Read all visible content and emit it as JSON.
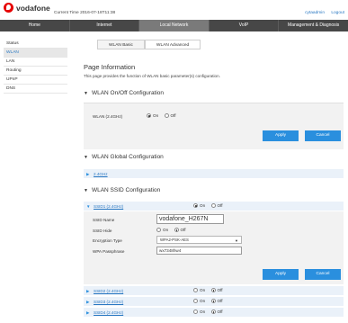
{
  "header": {
    "brand": "vodafone",
    "current_time_label": "Current Time",
    "current_time": "2016-07-18T11:38",
    "user": "cytaadmin",
    "logout": "Logout"
  },
  "nav": [
    {
      "label": "Home"
    },
    {
      "label": "Internet"
    },
    {
      "label": "Local Network",
      "active": true
    },
    {
      "label": "VoIP"
    },
    {
      "label": "Management & Diagnosis"
    }
  ],
  "sidebar": {
    "items": [
      {
        "label": "Status"
      },
      {
        "label": "WLAN",
        "active": true
      },
      {
        "label": "LAN"
      },
      {
        "label": "Routing"
      },
      {
        "label": "UPnP"
      },
      {
        "label": "DNS"
      }
    ]
  },
  "tabs": {
    "basic": "WLAN Basic",
    "advanced": "WLAN Advanced"
  },
  "page": {
    "title": "Page Information",
    "description": "This page provides the function of WLAN basic parameter(s) configuration."
  },
  "onoff": {
    "title": "WLAN On/Off Configuration",
    "field_label": "WLAN (2.4GHz)",
    "on": "On",
    "off": "Off",
    "value": "On",
    "apply": "Apply",
    "cancel": "Cancel"
  },
  "global": {
    "title": "WLAN Global Configuration",
    "band": "2.4GHz"
  },
  "ssid": {
    "title": "WLAN SSID Configuration",
    "ssid1": {
      "label": "SSID1 (2.4GHz)",
      "state": "On",
      "on": "On",
      "off": "Off",
      "name_label": "SSID Name",
      "name_value": "vodafone_H267N",
      "hide_label": "SSID Hide",
      "hide_on": "On",
      "hide_off": "Off",
      "hide_value": "Off",
      "enc_label": "Encryption Type",
      "enc_value": "WPA2-PSK-AES",
      "pass_label": "WPA Passphrase",
      "pass_value": "wx7348hw4",
      "apply": "Apply",
      "cancel": "Cancel"
    },
    "others": [
      {
        "label": "SSID2 (2.4GHz)",
        "on": "On",
        "off": "Off",
        "state": "Off"
      },
      {
        "label": "SSID3 (2.4GHz)",
        "on": "On",
        "off": "Off",
        "state": "Off"
      },
      {
        "label": "SSID4 (2.4GHz)",
        "on": "On",
        "off": "Off",
        "state": "Off"
      }
    ]
  },
  "colors": {
    "brand": "#e60000",
    "nav_bg": "#474747",
    "accent": "#2a8fde",
    "link": "#2a78c2"
  },
  "icons": {
    "section": "triangle-down-icon",
    "row": "triangle-right-icon",
    "select": "caret-down-icon"
  }
}
